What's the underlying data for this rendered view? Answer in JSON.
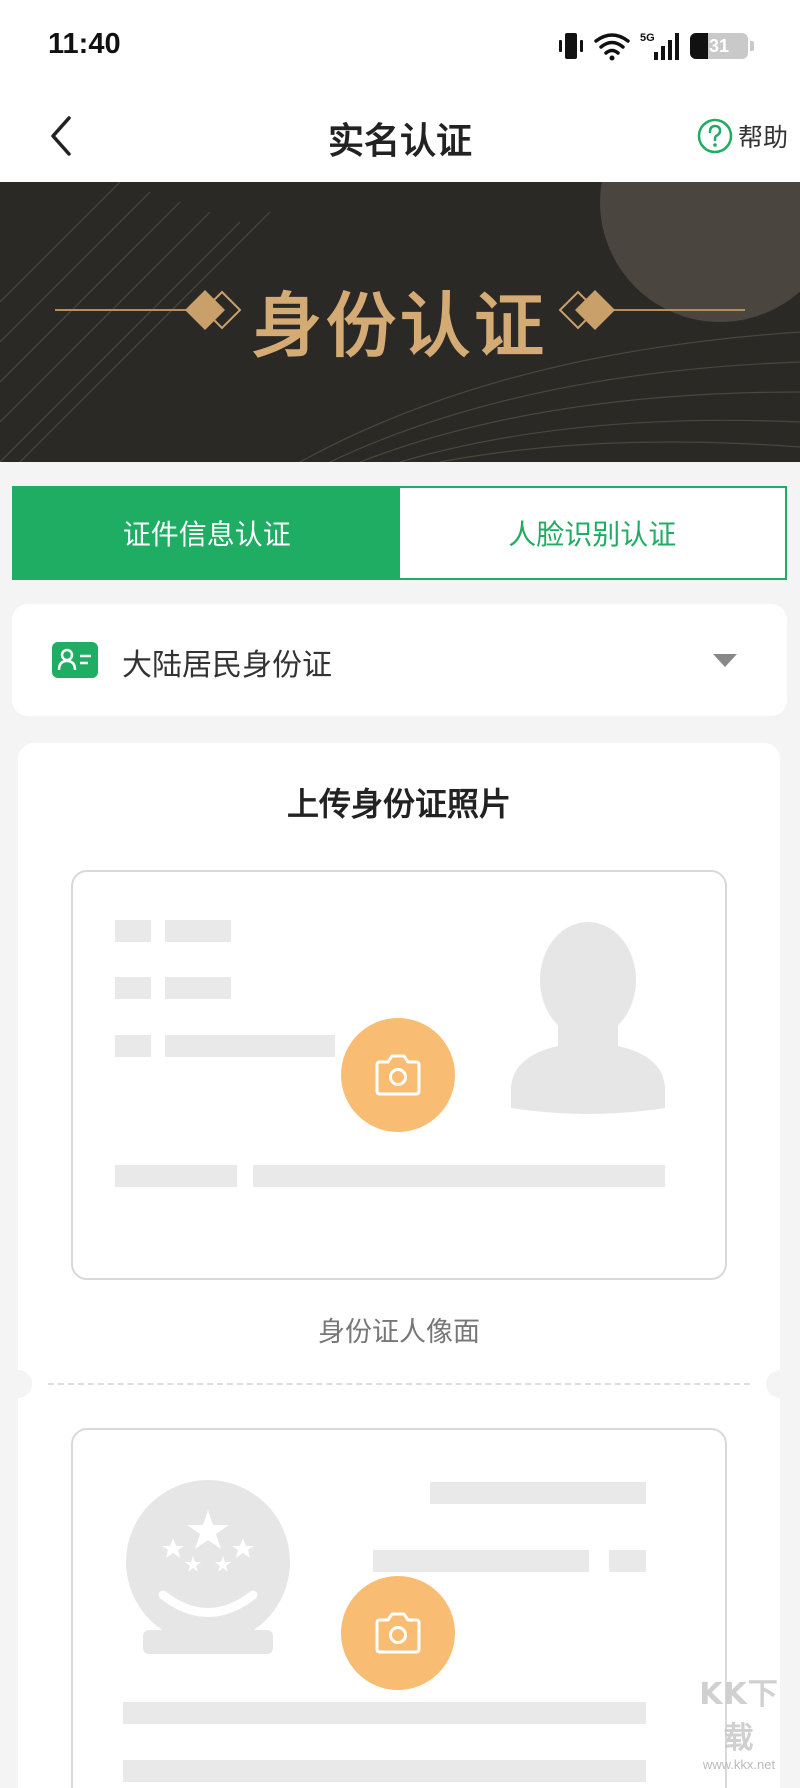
{
  "status_bar": {
    "time": "11:40",
    "network_label": "5G",
    "battery_level": "31",
    "battery_fraction": 0.31
  },
  "nav": {
    "title": "实名认证",
    "help_label": "帮助",
    "back_icon": "chevron-left-icon",
    "help_icon": "question-circle-icon"
  },
  "banner": {
    "title": "身份认证"
  },
  "tabs": [
    {
      "label": "证件信息认证",
      "active": true
    },
    {
      "label": "人脸识别认证",
      "active": false
    }
  ],
  "id_type": {
    "selected": "大陆居民身份证",
    "icon": "id-card-icon"
  },
  "upload": {
    "title": "上传身份证照片",
    "front_caption": "身份证人像面"
  },
  "watermark": {
    "main": "KK下载",
    "sub": "www.kkx.net"
  },
  "colors": {
    "accent": "#1fad64",
    "banner_bg": "#2b2925",
    "banner_gold": "#d4aa75",
    "camera_orange": "#f8bc72"
  }
}
